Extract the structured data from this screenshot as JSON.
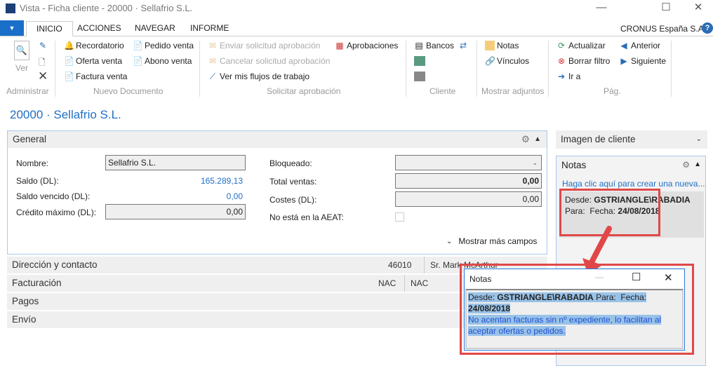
{
  "window": {
    "title": "Vista - Ficha cliente - 20000 · Sellafrio S.L.",
    "minimize": "—",
    "maximize": "☐",
    "close": "✕"
  },
  "ribbon": {
    "tabs": [
      {
        "label": "INICIO",
        "active": true
      },
      {
        "label": "ACCIONES"
      },
      {
        "label": "NAVEGAR"
      },
      {
        "label": "INFORME"
      }
    ],
    "company": "CRONUS España S.A.",
    "groups": {
      "administrar": {
        "label": "Administrar",
        "ver": "Ver"
      },
      "nuevo_documento": {
        "label": "Nuevo Documento",
        "items": [
          "Recordatorio",
          "Oferta venta",
          "Factura venta",
          "Pedido venta",
          "Abono venta"
        ]
      },
      "solicitar_aprobacion": {
        "label": "Solicitar aprobación",
        "items": [
          "Enviar solicitud aprobación",
          "Cancelar solicitud aprobación",
          "Ver mis flujos de trabajo",
          "Aprobaciones"
        ]
      },
      "cliente": {
        "label": "Cliente",
        "items": [
          "Bancos"
        ]
      },
      "mostrar_adjuntos": {
        "label": "Mostrar adjuntos",
        "items": [
          "Notas",
          "Vínculos"
        ]
      },
      "pag": {
        "label": "Pág.",
        "items": [
          "Actualizar",
          "Borrar filtro",
          "Ir a",
          "Anterior",
          "Siguiente"
        ]
      }
    }
  },
  "page_title": "20000 · Sellafrio S.L.",
  "general": {
    "header": "General",
    "nombre_label": "Nombre:",
    "nombre": "Sellafrio S.L.",
    "saldo_label": "Saldo (DL):",
    "saldo": "165.289,13",
    "saldo_vencido_label": "Saldo vencido (DL):",
    "saldo_vencido": "0,00",
    "credito_label": "Crédito máximo (DL):",
    "credito": "0,00",
    "bloqueado_label": "Bloqueado:",
    "bloqueado": "",
    "total_ventas_label": "Total ventas:",
    "total_ventas": "0,00",
    "costes_label": "Costes (DL):",
    "costes": "0,00",
    "aeat_label": "No está en la AEAT:",
    "aeat_checked": false,
    "more": "Mostrar más campos"
  },
  "sections": [
    {
      "label": "Dirección y contacto",
      "summary": [
        "46010",
        "Sr. Mark McArthur"
      ]
    },
    {
      "label": "Facturación",
      "summary": [
        "NAC",
        "NAC"
      ]
    },
    {
      "label": "Pagos"
    },
    {
      "label": "Envío"
    }
  ],
  "factbox": {
    "imagen": "Imagen de cliente",
    "notas": "Notas",
    "create_link": "Haga clic aquí para crear una nueva...",
    "note": {
      "desde": "Desde:",
      "user": "GSTRIANGLE\\RABADIA",
      "para": "Para:",
      "fecha": "Fecha:",
      "date": "24/08/2018"
    }
  },
  "popup": {
    "title": "Notas",
    "desde": "Desde:",
    "user": "GSTRIANGLE\\RABADIA",
    "para": "Para:",
    "fecha": "Fecha:",
    "date": "24/08/2018",
    "text": "No acentan facturas sin nº expediente, lo facilitan al aceptar ofertas o pedidos."
  },
  "colors": {
    "accent": "#1f6fc4",
    "highlight": "#e04848",
    "selection": "#99c2e8"
  }
}
